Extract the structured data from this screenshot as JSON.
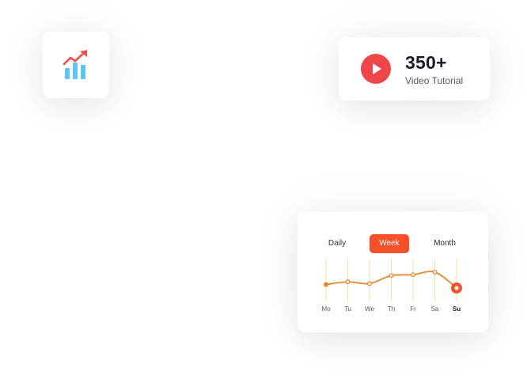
{
  "colors": {
    "accent": "#f5502a",
    "play_red": "#f0464a",
    "line_orange": "#e2882c",
    "grid_yellow": "#f2e39c",
    "icon_blue": "#5ec6f5",
    "icon_red": "#f24e45",
    "axis_text": "#55596a"
  },
  "stats_card": {
    "icon": "growth-chart-icon"
  },
  "video_card": {
    "icon": "play-icon",
    "count": "350+",
    "label": "Video Tutorial"
  },
  "chart_card": {
    "tabs": [
      {
        "label": "Daily",
        "active": false
      },
      {
        "label": "Week",
        "active": true
      },
      {
        "label": "Month",
        "active": false
      }
    ]
  },
  "chart_data": {
    "type": "line",
    "x": [
      "Mo",
      "Tu",
      "We",
      "Th",
      "Fr",
      "Sa",
      "Su"
    ],
    "series": [
      {
        "values": [
          42,
          48,
          44,
          62,
          64,
          70,
          34
        ]
      }
    ],
    "highlighted_point": "Su",
    "ylim": [
      0,
      100
    ],
    "grid": true
  }
}
